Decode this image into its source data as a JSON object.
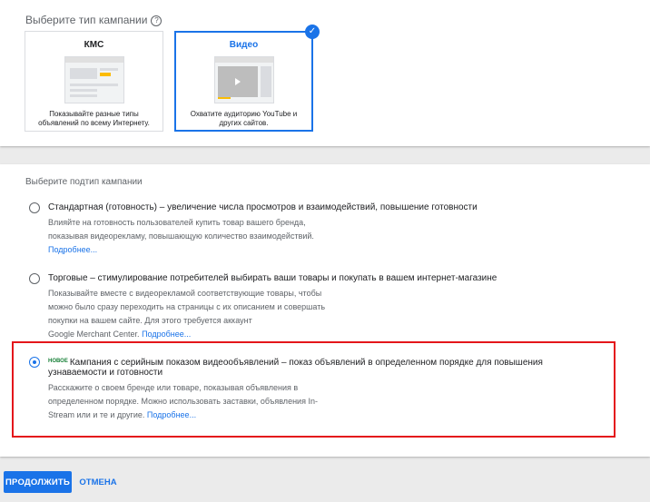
{
  "campaign_type": {
    "title": "Выберите тип кампании",
    "help_icon": "?",
    "cards": [
      {
        "title": "КМС",
        "description": "Показывайте разные типы объявлений по всему Интернету.",
        "selected": false
      },
      {
        "title": "Видео",
        "description": "Охватите аудиторию YouTube и других сайтов.",
        "selected": true
      }
    ]
  },
  "subtype": {
    "title": "Выберите подтип кампании",
    "options": [
      {
        "title": "Стандартная (готовность) – увеличение числа просмотров и взаимодействий, повышение готовности",
        "desc_lines": [
          "Влияйте на готовность пользователей купить товар вашего бренда,",
          "показывая видеорекламу, повышающую количество взаимодействий."
        ],
        "link": "Подробнее...",
        "selected": false
      },
      {
        "title": "Торговые – стимулирование потребителей выбирать ваши товары и покупать в вашем интернет-магазине",
        "desc_lines": [
          "Показывайте вместе с видеорекламой соответствующие товары, чтобы",
          "можно было сразу переходить на страницы с их описанием и совершать",
          "покупки на вашем сайте. Для этого требуется аккаунт",
          "Google Merchant Center."
        ],
        "link": "Подробнее...",
        "selected": false
      },
      {
        "badge": "НОВОЕ",
        "title": "Кампания с серийным показом видеообъявлений – показ объявлений в определенном порядке для повышения узнаваемости и готовности",
        "desc_lines": [
          "Расскажите о своем бренде или товаре, показывая объявления в",
          "определенном порядке. Можно использовать заставки, объявления In-",
          "Stream или и те и другие."
        ],
        "link": "Подробнее...",
        "selected": true
      }
    ]
  },
  "actions": {
    "continue_label": "ПРОДОЛЖИТЬ",
    "cancel_label": "ОТМЕНА"
  },
  "colors": {
    "accent": "#1a73e8",
    "highlight": "#e4161b",
    "new_badge": "#188038"
  }
}
